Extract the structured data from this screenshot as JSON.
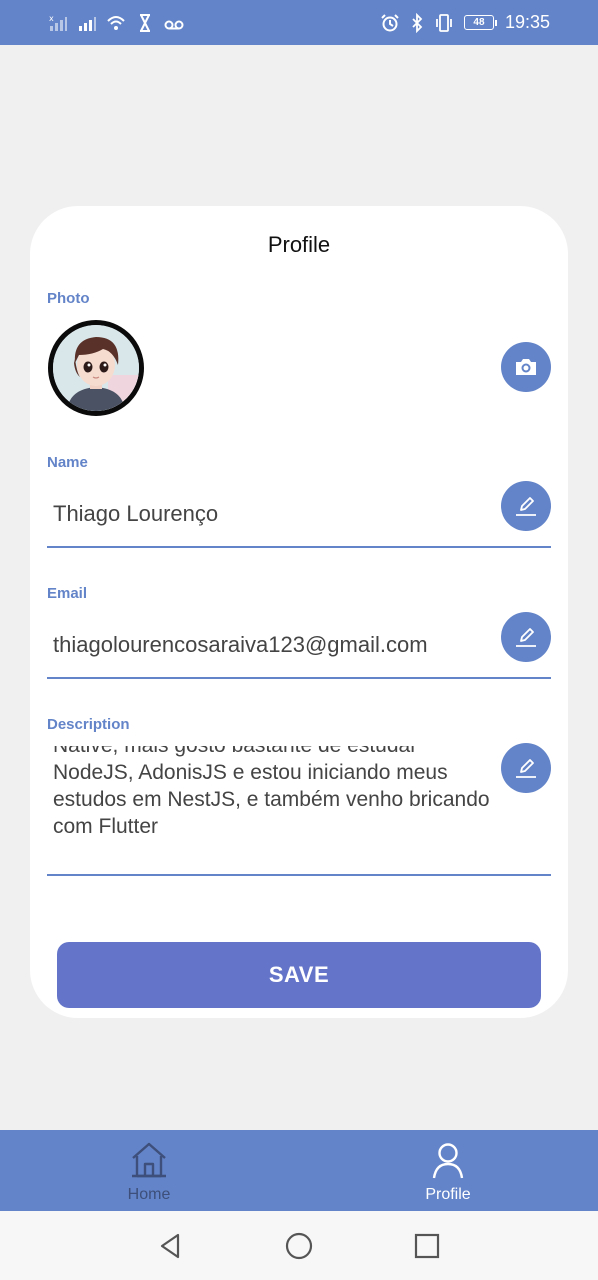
{
  "status_bar": {
    "time": "19:35",
    "battery": "48",
    "icons_left": [
      "signal-off-icon",
      "signal-icon",
      "wifi-icon",
      "hourglass-icon",
      "voicemail-icon"
    ],
    "icons_right": [
      "alarm-icon",
      "bluetooth-icon",
      "vibrate-icon",
      "battery-icon"
    ]
  },
  "card": {
    "title": "Profile",
    "photo": {
      "label": "Photo",
      "button_icon": "camera-icon"
    },
    "name": {
      "label": "Name",
      "value": "Thiago Lourenço",
      "button_icon": "pencil-icon"
    },
    "email": {
      "label": "Email",
      "value": "thiagolourencosaraiva123@gmail.com",
      "button_icon": "pencil-icon"
    },
    "description": {
      "label": "Description",
      "value": "Native, mais gosto bastante de estudar NodeJS, AdonisJS e estou iniciando meus estudos em NestJS, e também venho bricando com Flutter",
      "button_icon": "pencil-icon"
    },
    "save_label": "SAVE"
  },
  "tabs": [
    {
      "label": "Home",
      "icon": "home-icon",
      "active": false
    },
    {
      "label": "Profile",
      "icon": "user-icon",
      "active": true
    }
  ],
  "nav": [
    "back-icon",
    "home-circle-icon",
    "recents-icon"
  ],
  "colors": {
    "accent": "#6384c8",
    "save_button": "#6475c9",
    "background": "#f0f0f0",
    "card": "#ffffff"
  }
}
